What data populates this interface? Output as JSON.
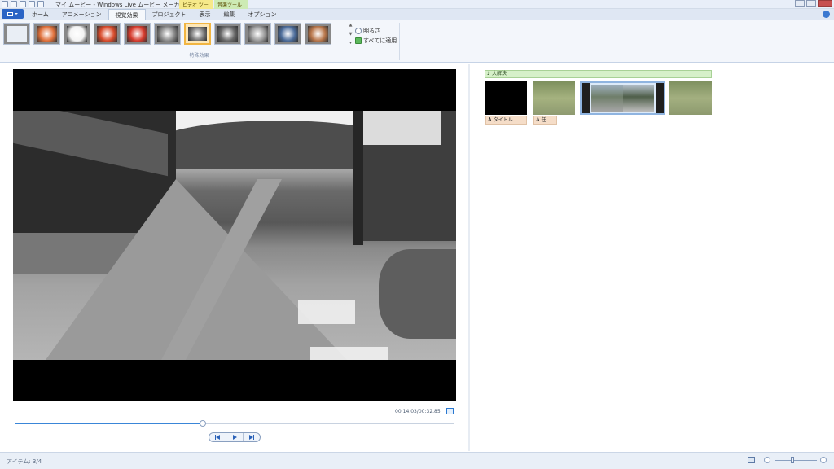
{
  "window": {
    "title": "マイ ムービー - Windows Live ムービー メーカー",
    "context_tabs": [
      "ビデオ ツール",
      "音楽ツール"
    ]
  },
  "ribbon": {
    "tabs": [
      {
        "label": "ホーム",
        "active": false
      },
      {
        "label": "アニメーション",
        "active": false
      },
      {
        "label": "視覚効果",
        "active": true
      },
      {
        "label": "プロジェクト",
        "active": false
      },
      {
        "label": "表示",
        "active": false
      },
      {
        "label": "編集",
        "active": false
      },
      {
        "label": "オプション",
        "active": false
      }
    ],
    "effects_group_label": "特殊効果",
    "brightness_label": "明るさ",
    "apply_all_label": "すべてに適用",
    "effect_colors": [
      "#e9eef5",
      "#e0703a",
      "#f4f4f4",
      "#d84a2a",
      "#d63a2c",
      "#8a8a8a",
      "#7a7a7a",
      "#6a6a6a",
      "#9a9a9a",
      "#4b6b99",
      "#b8764a"
    ],
    "selected_effect_index": 6
  },
  "preview": {
    "timecode": "00:14.03/00:32.85",
    "progress": 0.427
  },
  "storyboard": {
    "music_label": "大解決",
    "captions": [
      "タイトル",
      "任..."
    ]
  },
  "status": {
    "items_text": "アイテム: 3/4"
  }
}
